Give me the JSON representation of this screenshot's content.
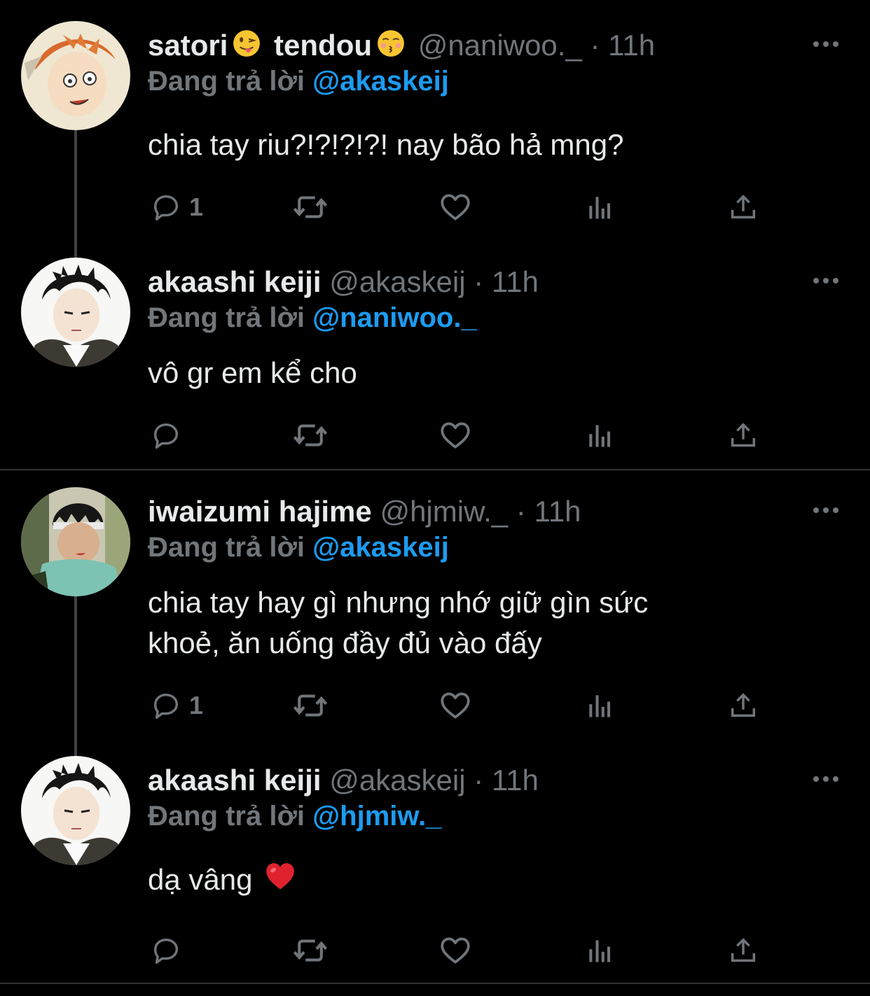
{
  "tweets": [
    {
      "display_name": "satori",
      "display_name_2": "tendou",
      "emoji_1": "tongue-out-face",
      "emoji_2": "kissing-face",
      "handle": "@naniwoo._",
      "separator": "·",
      "time": "11h",
      "reply_label": "Đang trả lời",
      "reply_to": "@akaskeij",
      "text": "chia tay riu?!?!?!?! nay bão hả mng?",
      "reply_count": "1",
      "avatar": "orange-haired-character"
    },
    {
      "display_name": "akaashi keiji",
      "handle": "@akaskeij",
      "separator": "·",
      "time": "11h",
      "reply_label": "Đang trả lời",
      "reply_to": "@naniwoo._",
      "text": "vô gr em kể cho",
      "reply_count": "",
      "avatar": "dark-haired-character"
    },
    {
      "display_name": "iwaizumi hajime",
      "handle": "@hjmiw._",
      "separator": "·",
      "time": "11h",
      "reply_label": "Đang trả lời",
      "reply_to": "@akaskeij",
      "text_line_1": "chia tay hay gì nhưng nhớ giữ gìn sức",
      "text_line_2": "khoẻ, ăn uống đầy đủ vào đấy",
      "reply_count": "1",
      "avatar": "spiky-haired-character"
    },
    {
      "display_name": "akaashi keiji",
      "handle": "@akaskeij",
      "separator": "·",
      "time": "11h",
      "reply_label": "Đang trả lời",
      "reply_to": "@hjmiw._",
      "text": "dạ vâng",
      "text_emoji": "red-heart",
      "reply_count": "",
      "avatar": "dark-haired-character"
    }
  ],
  "icons": {
    "reply": "reply-icon",
    "retweet": "retweet-icon",
    "like": "like-icon",
    "views": "views-icon",
    "share": "share-icon",
    "more": "more-icon"
  },
  "colors": {
    "background": "#000000",
    "text": "#e7e9ea",
    "secondary": "#71767b",
    "mention": "#1d9bf0",
    "divider": "#2f3336",
    "thread_line": "#3e4144"
  }
}
